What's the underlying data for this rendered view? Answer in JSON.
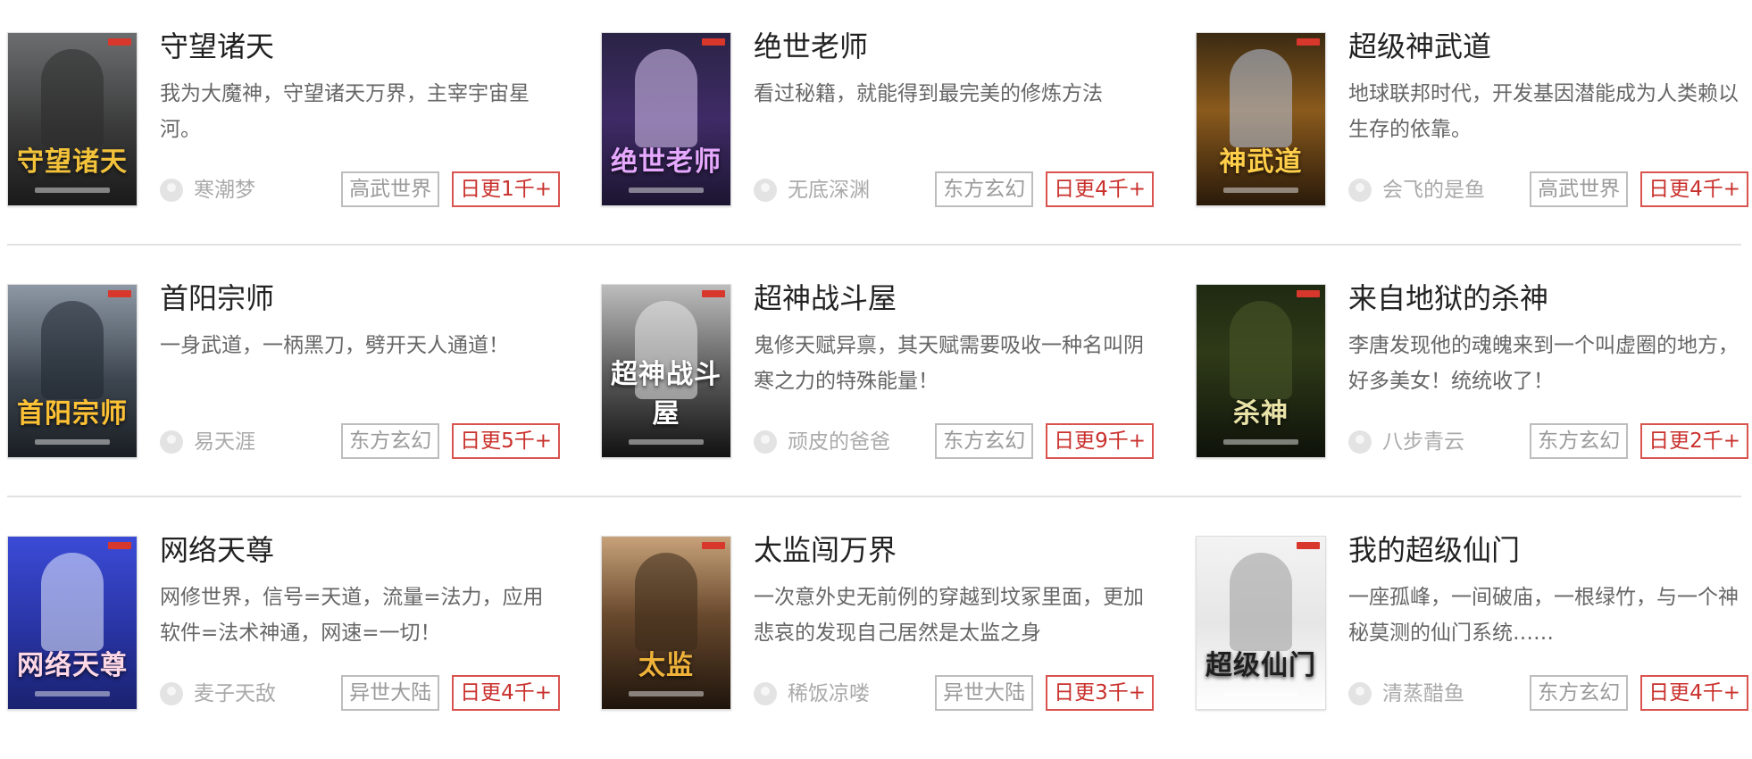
{
  "accent_color": "#c9302c",
  "books": [
    {
      "title": "守望诸天",
      "desc": "我为大魔神，守望诸天万界，主宰宇宙星河。",
      "author": "寒潮梦",
      "genre": "高武世界",
      "update": "日更1千+",
      "cover": {
        "text": "守望诸天",
        "bg": "linear-gradient(180deg,#6b6e6f 0%,#3a3a3a 55%,#1a1a1a 100%)",
        "text_color": "#f3c23b",
        "figure_color": "#2b2b2b"
      }
    },
    {
      "title": "绝世老师",
      "desc": "看过秘籍，就能得到最完美的修炼方法",
      "author": "无底深渊",
      "genre": "东方玄幻",
      "update": "日更4千+",
      "cover": {
        "text": "绝世老师",
        "bg": "linear-gradient(180deg,#2a2446 0%,#3f2b66 50%,#1c1531 100%)",
        "text_color": "#e7a9ff",
        "figure_color": "#d8c4f0"
      }
    },
    {
      "title": "超级神武道",
      "desc": "地球联邦时代，开发基因潜能成为人类赖以生存的依靠。",
      "author": "会飞的是鱼",
      "genre": "高武世界",
      "update": "日更4千+",
      "cover": {
        "text": "神武道",
        "bg": "linear-gradient(180deg,#3b2a12 0%,#8a5a1c 45%,#2a1a0a 100%)",
        "text_color": "#ffcf4a",
        "figure_color": "#b8c7e0"
      }
    },
    {
      "title": "首阳宗师",
      "desc": "一身武道，一柄黑刀，劈开天人通道！",
      "author": "易天涯",
      "genre": "东方玄幻",
      "update": "日更5千+",
      "cover": {
        "text": "首阳宗师",
        "bg": "linear-gradient(180deg,#8d98a4 0%,#3d4650 55%,#1a1e23 100%)",
        "text_color": "#ffc234",
        "figure_color": "#1f2630"
      }
    },
    {
      "title": "超神战斗屋",
      "desc": "鬼修天赋异禀，其天赋需要吸收一种名叫阴寒之力的特殊能量！",
      "author": "顽皮的爸爸",
      "genre": "东方玄幻",
      "update": "日更9千+",
      "cover": {
        "text": "超神战斗屋",
        "bg": "linear-gradient(180deg,#bdbdbd 0%,#5e5e5e 50%,#111111 100%)",
        "text_color": "#ffffff",
        "figure_color": "#e8e8e8"
      }
    },
    {
      "title": "来自地狱的杀神",
      "desc": "李唐发现他的魂魄来到一个叫虚圈的地方，好多美女！统统收了！",
      "author": "八步青云",
      "genre": "东方玄幻",
      "update": "日更2千+",
      "cover": {
        "text": "杀神",
        "bg": "linear-gradient(180deg,#1f2a12 0%,#2f3a18 40%,#0e120a 100%)",
        "text_color": "#e9e3a8",
        "figure_color": "#4b5a2a"
      }
    },
    {
      "title": "网络天尊",
      "desc": "网修世界，信号=天道，流量=法力，应用软件=法术神通，网速=一切！",
      "author": "麦子天敌",
      "genre": "异世大陆",
      "update": "日更4千+",
      "cover": {
        "text": "网络天尊",
        "bg": "linear-gradient(180deg,#3b4bd6 0%,#2a36a8 50%,#1a2270 100%)",
        "text_color": "#ffd8e6",
        "figure_color": "#e8ecff"
      }
    },
    {
      "title": "太监闯万界",
      "desc": "一次意外史无前例的穿越到坟冢里面，更加悲哀的发现自己居然是太监之身",
      "author": "稀饭凉喽",
      "genre": "异世大陆",
      "update": "日更3千+",
      "cover": {
        "text": "太监",
        "bg": "linear-gradient(180deg,#c7a27a 0%,#6a4a2e 45%,#1e140c 100%)",
        "text_color": "#f0b33a",
        "figure_color": "#3b2a1a"
      }
    },
    {
      "title": "我的超级仙门",
      "desc": "一座孤峰，一间破庙，一根绿竹，与一个神秘莫测的仙门系统……",
      "author": "清蒸醋鱼",
      "genre": "东方玄幻",
      "update": "日更4千+",
      "cover": {
        "text": "超级仙门",
        "bg": "linear-gradient(180deg,#f3f3f3 0%,#e6e6e6 50%,#ffffff 100%)",
        "text_color": "#1f1f1f",
        "figure_color": "#9a9a9a"
      }
    }
  ]
}
